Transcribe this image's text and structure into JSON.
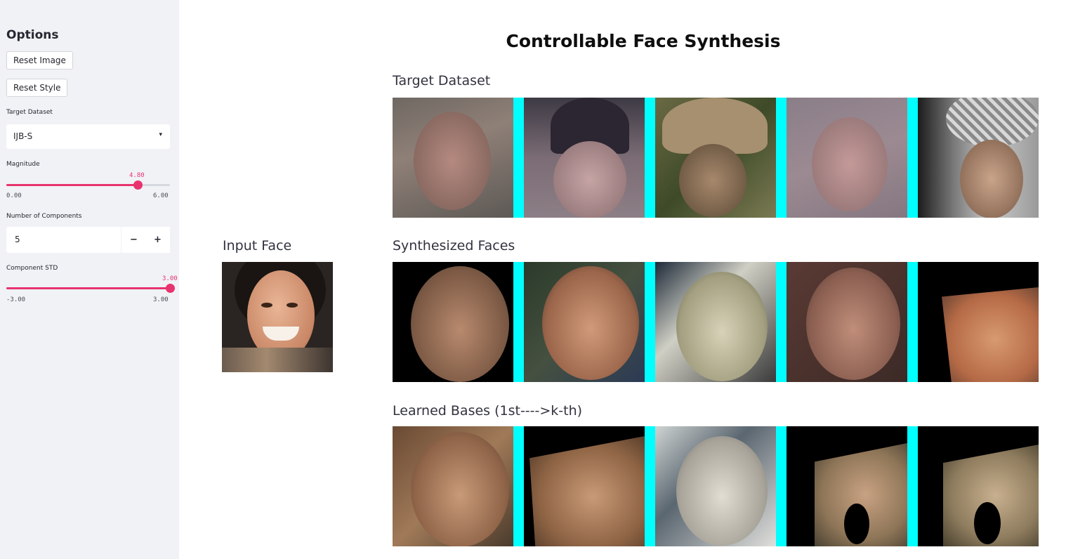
{
  "sidebar": {
    "title": "Options",
    "reset_image_label": "Reset Image",
    "reset_style_label": "Reset Style",
    "dataset": {
      "label": "Target Dataset",
      "selected": "IJB-S"
    },
    "magnitude": {
      "label": "Magnitude",
      "value": "4.80",
      "min": "0.00",
      "max": "6.00",
      "fraction": 0.8
    },
    "components": {
      "label": "Number of Components",
      "value": "5",
      "minus": "−",
      "plus": "+"
    },
    "component_std": {
      "label": "Component STD",
      "value": "3.00",
      "min": "-3.00",
      "max": "3.00",
      "fraction": 1.0
    }
  },
  "main": {
    "title": "Controllable Face Synthesis",
    "input_face_label": "Input Face",
    "target_label": "Target Dataset",
    "synth_label": "Synthesized Faces",
    "bases_label": "Learned Bases (1st---->k-th)"
  },
  "colors": {
    "accent": "#e8336e",
    "separator": "#00ffff",
    "sidebar_bg": "#f0f2f6"
  }
}
